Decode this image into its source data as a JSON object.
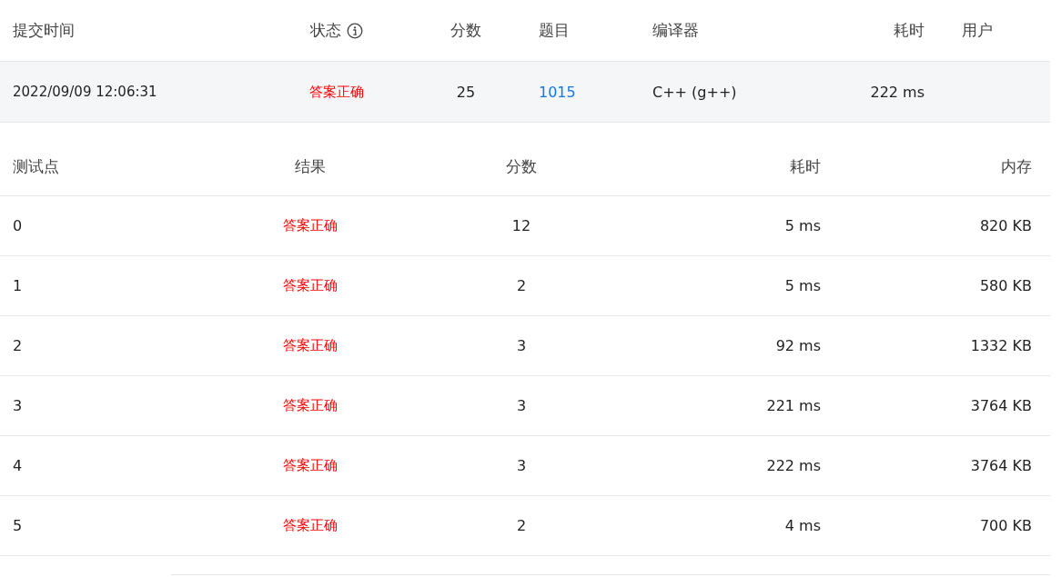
{
  "submission": {
    "columns": [
      "提交时间",
      "状态",
      "分数",
      "题目",
      "编译器",
      "耗时",
      "用户"
    ],
    "row": {
      "time": "2022/09/09 12:06:31",
      "status": {
        "text": "答案正确",
        "color": "#ff0000"
      },
      "score": "25",
      "problem": "1015",
      "compiler": "C++ (g++)",
      "duration": "222 ms"
    }
  },
  "test_cases": {
    "columns": [
      "测试点",
      "结果",
      "分数",
      "耗时",
      "内存"
    ],
    "rows": [
      {
        "case": "0",
        "result": {
          "text": "答案正确",
          "color": "#ff0000"
        },
        "score": "12",
        "duration": "5 ms",
        "memory": "820 KB"
      },
      {
        "case": "1",
        "result": {
          "text": "答案正确",
          "color": "#ff0000"
        },
        "score": "2",
        "duration": "5 ms",
        "memory": "580 KB"
      },
      {
        "case": "2",
        "result": {
          "text": "答案正确",
          "color": "#ff0000"
        },
        "score": "3",
        "duration": "92 ms",
        "memory": "1332 KB"
      },
      {
        "case": "3",
        "result": {
          "text": "答案正确",
          "color": "#ff0000"
        },
        "score": "3",
        "duration": "221 ms",
        "memory": "3764 KB"
      },
      {
        "case": "4",
        "result": {
          "text": "答案正确",
          "color": "#ff0000"
        },
        "score": "3",
        "duration": "222 ms",
        "memory": "3764 KB"
      },
      {
        "case": "5",
        "result": {
          "text": "答案正确",
          "color": "#ff0000"
        },
        "score": "2",
        "duration": "4 ms",
        "memory": "700 KB"
      }
    ]
  }
}
